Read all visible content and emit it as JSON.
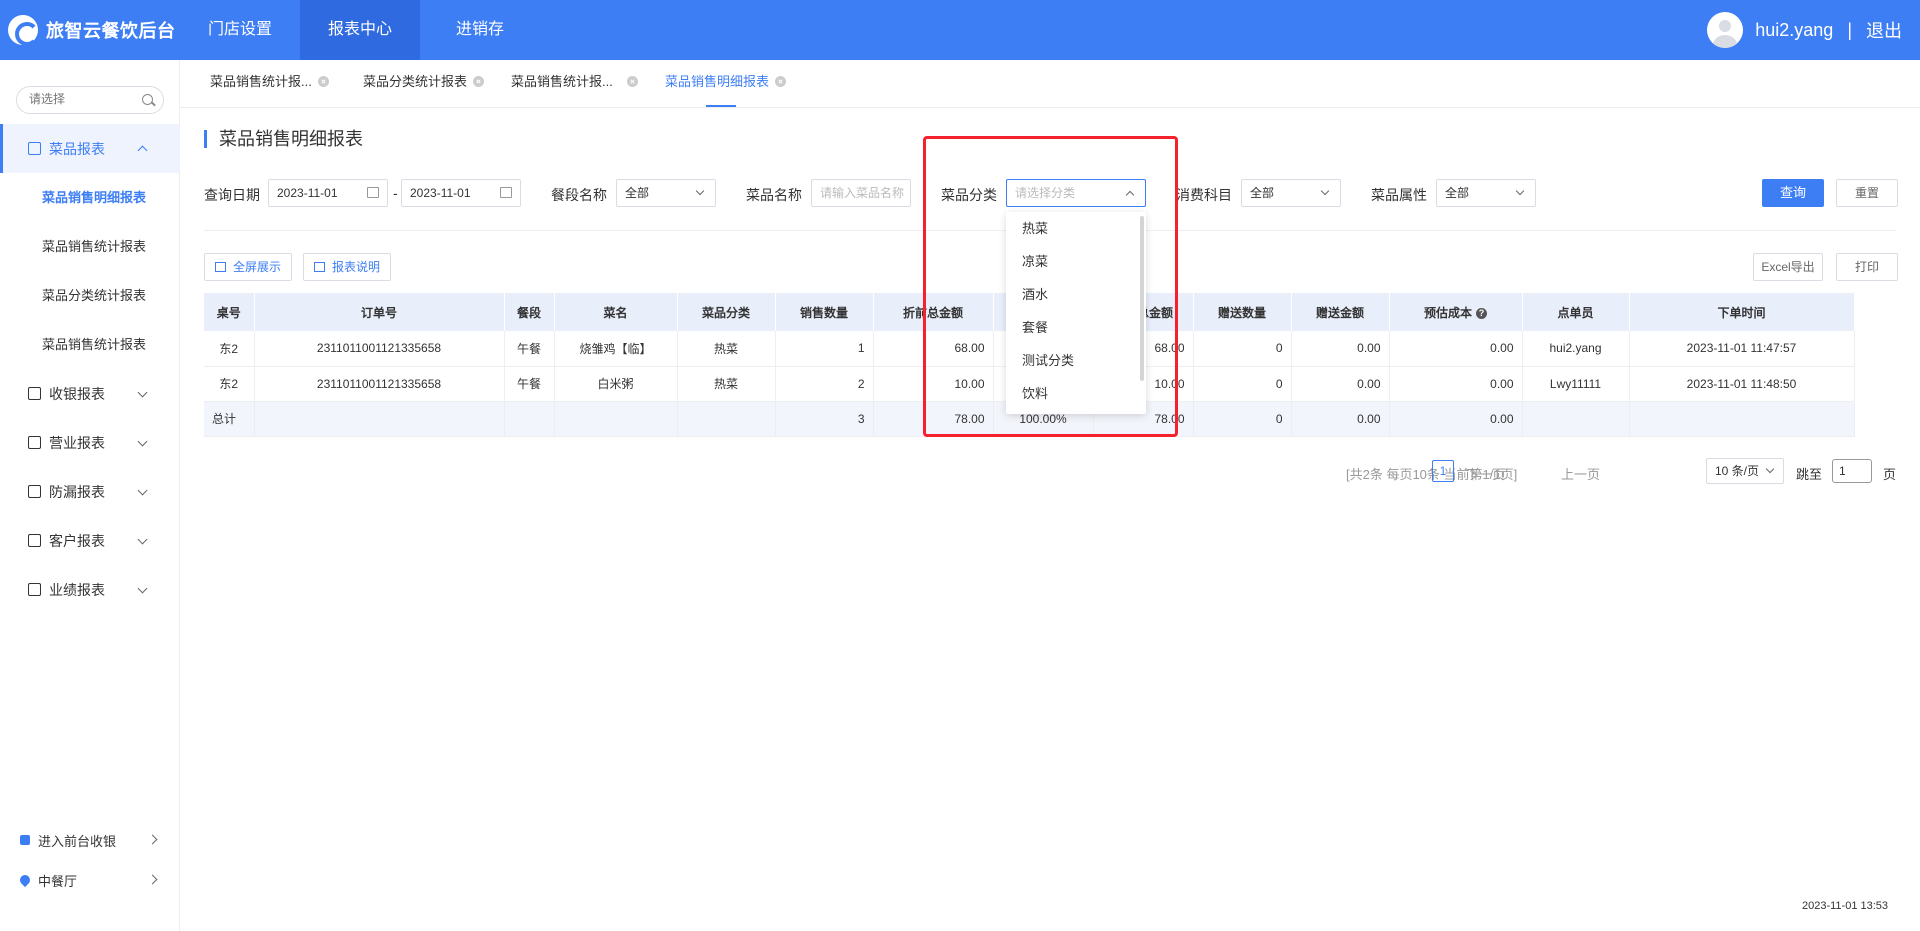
{
  "app": {
    "title": "旅智云餐饮后台"
  },
  "nav": [
    "门店设置",
    "报表中心",
    "进销存"
  ],
  "user": {
    "name": "hui2.yang",
    "separator": "|",
    "logout": "退出"
  },
  "sidebar": {
    "search_placeholder": "请选择",
    "group_dish": "菜品报表",
    "sub_items": [
      "菜品销售明细报表",
      "菜品销售统计报表",
      "菜品分类统计报表",
      "菜品销售统计报表"
    ],
    "groups": [
      "收银报表",
      "营业报表",
      "防漏报表",
      "客户报表",
      "业绩报表"
    ],
    "bottom_pos": "进入前台收银",
    "bottom_store": "中餐厅"
  },
  "tabs": [
    "菜品销售统计报...",
    "菜品分类统计报表",
    "菜品销售统计报...",
    "菜品销售明细报表"
  ],
  "page": {
    "title": "菜品销售明细报表",
    "filters": {
      "date_label": "查询日期",
      "date_from": "2023-11-01",
      "date_dash": "-",
      "date_to": "2023-11-01",
      "period_label": "餐段名称",
      "period_value": "全部",
      "dish_label": "菜品名称",
      "dish_placeholder": "请输入菜品名称",
      "category_label": "菜品分类",
      "category_placeholder": "请选择分类",
      "expense_label": "消费科目",
      "expense_value": "全部",
      "attr_label": "菜品属性",
      "attr_value": "全部",
      "query": "查询",
      "reset": "重置"
    },
    "toolbar": {
      "fullscreen": "全屏展示",
      "explain": "报表说明",
      "excel": "Excel导出",
      "print": "打印"
    }
  },
  "table": {
    "headers": [
      "桌号",
      "订单号",
      "餐段",
      "菜名",
      "菜品分类",
      "销售数量",
      "折前总金额",
      "",
      "折后总金额",
      "赠送数量",
      "赠送金额",
      "预估成本",
      "点单员",
      "下单时间"
    ],
    "rows": [
      [
        "东2",
        "2311011001121335658",
        "午餐",
        "烧雏鸡【临】",
        "热菜",
        "1",
        "68.00",
        "",
        "68.00",
        "0",
        "0.00",
        "0.00",
        "hui2.yang",
        "2023-11-01 11:47:57"
      ],
      [
        "东2",
        "2311011001121335658",
        "午餐",
        "白米粥",
        "热菜",
        "2",
        "10.00",
        "",
        "10.00",
        "0",
        "0.00",
        "0.00",
        "Lwy11111",
        "2023-11-01 11:48:50"
      ]
    ],
    "total": [
      "总计",
      "",
      "",
      "",
      "",
      "3",
      "78.00",
      "100.00%",
      "78.00",
      "0",
      "0.00",
      "0.00",
      "",
      ""
    ]
  },
  "pagination": {
    "summary": "[共2条 每页10条 当前第1/1页]",
    "prev": "上一页",
    "current": "1",
    "next": "下一页",
    "page_size": "10 条/页",
    "jump_label": "跳至",
    "jump_value": "1",
    "page_unit": "页"
  },
  "dropdown": {
    "options": [
      "热菜",
      "凉菜",
      "酒水",
      "套餐",
      "测试分类",
      "饮料"
    ]
  },
  "footer": {
    "timestamp": "2023-11-01 13:53"
  },
  "colors": {
    "primary": "#3d7ef5",
    "highlight": "#f5222d"
  }
}
